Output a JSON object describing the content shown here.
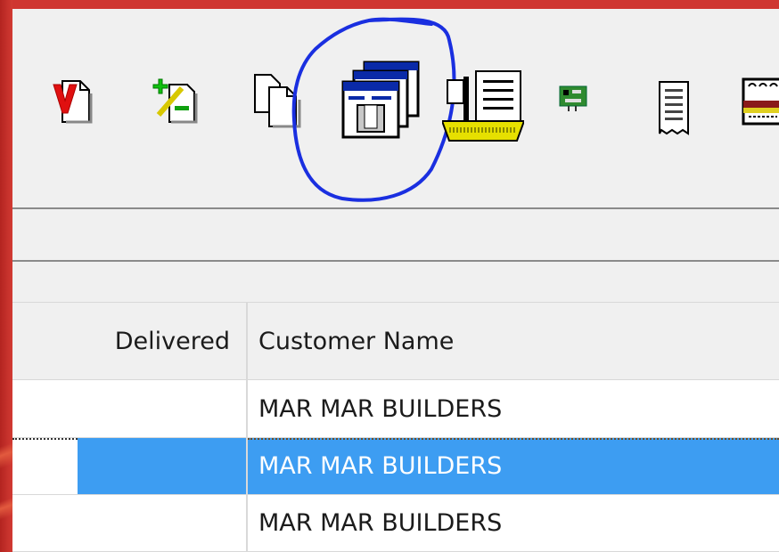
{
  "toolbar": {
    "buttons": [
      {
        "name": "void-document",
        "icon": "void-v-icon"
      },
      {
        "name": "adjust",
        "icon": "plus-minus-icon"
      },
      {
        "name": "copy",
        "icon": "copy-pages-icon"
      },
      {
        "name": "batch-windows",
        "icon": "stacked-windows-icon",
        "highlighted": true
      },
      {
        "name": "list-sign",
        "icon": "sign-list-icon"
      },
      {
        "name": "network",
        "icon": "network-card-icon"
      },
      {
        "name": "receipt",
        "icon": "receipt-icon"
      },
      {
        "name": "cash-drawer",
        "icon": "cash-drawer-icon"
      }
    ],
    "highlight_color": "#1a2fe0"
  },
  "grid": {
    "columns": [
      "Delivered",
      "Customer Name"
    ],
    "rows": [
      {
        "delivered": "",
        "customer_name": "MAR MAR BUILDERS",
        "selected": false
      },
      {
        "delivered": "",
        "customer_name": "MAR MAR BUILDERS",
        "selected": true
      },
      {
        "delivered": "",
        "customer_name": "MAR MAR BUILDERS",
        "selected": false
      }
    ],
    "selection_color": "#3d9df2"
  },
  "colors": {
    "frame": "#c62f2b",
    "window_bg": "#f0f0f0"
  }
}
